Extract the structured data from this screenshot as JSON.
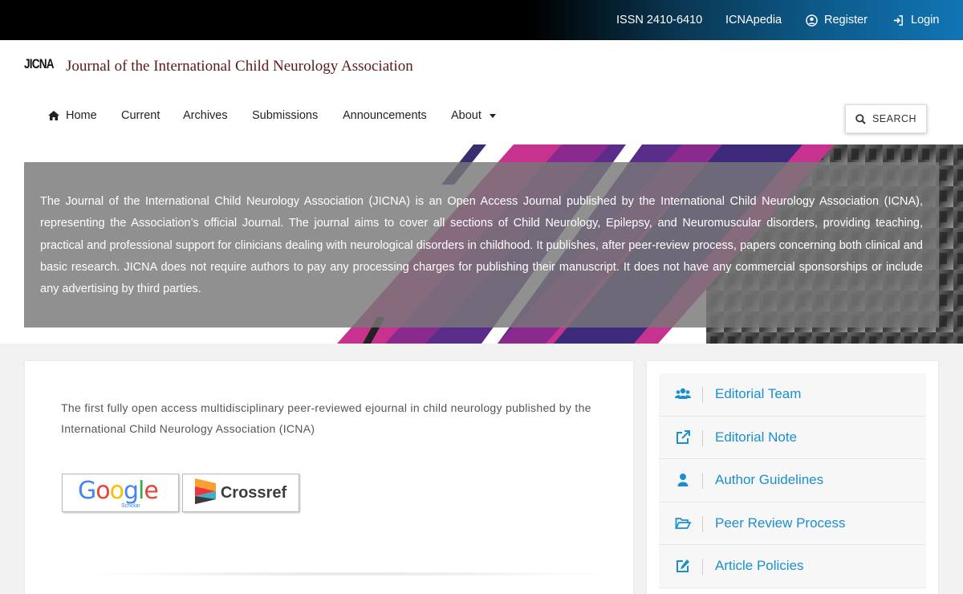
{
  "topbar": {
    "issn": "ISSN 2410-6410",
    "icnapedia": "ICNApedia",
    "register": "Register",
    "login": "Login"
  },
  "header": {
    "logo": "JICNA",
    "title": "Journal of the International Child Neurology Association"
  },
  "nav": {
    "items": [
      {
        "label": "Home",
        "icon": "home-icon"
      },
      {
        "label": "Current"
      },
      {
        "label": "Archives"
      },
      {
        "label": "Submissions"
      },
      {
        "label": "Announcements"
      },
      {
        "label": "About",
        "dropdown": true
      }
    ],
    "search_label": "SEARCH"
  },
  "hero": {
    "text": "The Journal of the International Child Neurology Association (JICNA) is an Open Access Journal published by the International Child Neurology Association (ICNA), representing the Association’s official Journal. The journal aims to cover all sections of Child Neurology, Epilepsy, and Neuromuscular disorders, providing teaching, practical and professional support for clinicians dealing with neurological disorders in childhood. It publishes, after peer-review process, papers concerning both clinical and basic research. JICNA does not require authors to pay any processing charges for publishing their manuscript. It does not have any commercial sponsorships or include any advertising by third parties."
  },
  "main": {
    "intro": "The first fully open access multidisciplinary peer-reviewed ejournal in child neurology published by the International Child Neurology Association (ICNA)",
    "badges": {
      "google_letters": [
        "G",
        "o",
        "o",
        "g",
        "l",
        "e"
      ],
      "google_sub": "Scholar",
      "crossref": "Crossref"
    }
  },
  "sidebar": {
    "items": [
      {
        "label": "Editorial Team",
        "icon": "users-icon"
      },
      {
        "label": "Editorial Note",
        "icon": "external-link-icon"
      },
      {
        "label": "Author Guidelines",
        "icon": "user-icon"
      },
      {
        "label": "Peer Review Process",
        "icon": "folder-open-icon"
      },
      {
        "label": "Article Policies",
        "icon": "edit-icon"
      }
    ]
  },
  "colors": {
    "accent": "#1a8fcf",
    "title": "#5a1a1a",
    "hero_overlay": "#787878"
  }
}
